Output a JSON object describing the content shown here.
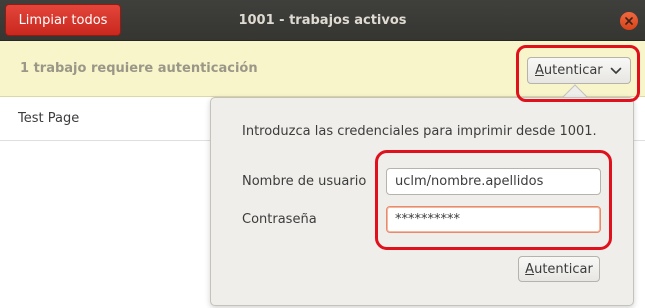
{
  "header": {
    "clear_all_label": "Limpiar todos",
    "title": "1001 - trabajos activos",
    "close_icon": "close-icon",
    "close_color": "#e35b2a"
  },
  "infobar": {
    "message": "1 trabajo requiere autenticación",
    "auth_button_label": "Autenticar",
    "dropdown_icon": "chevron-down-icon",
    "background": "#f7f5c9"
  },
  "jobs": [
    {
      "name": "Test Page"
    }
  ],
  "auth_popover": {
    "prompt": "Introduzca las credenciales para imprimir desde 1001.",
    "username_label": "Nombre de usuario",
    "username_value": "uclm/nombre.apellidos",
    "password_label": "Contraseña",
    "password_value": "**********",
    "submit_label": "Autenticar"
  },
  "annotation": {
    "highlight_color": "#e0101c"
  }
}
